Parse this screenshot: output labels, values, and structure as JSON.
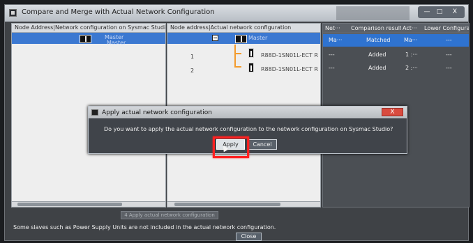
{
  "window": {
    "title": "Compare and Merge with Actual Network Configuration",
    "controls": {
      "minimize": "—",
      "maximize": "□",
      "close": "X"
    }
  },
  "left_pane": {
    "header": "Node Address|Network configuration on Sysmac Studi",
    "master_primary": "Master",
    "master_secondary": "Master"
  },
  "middle_pane": {
    "header": "Node address|Actual network configuration",
    "master": "Master",
    "rows": [
      {
        "node": "1",
        "device": "R88D-1SN01L-ECT R"
      },
      {
        "node": "2",
        "device": "R88D-1SN01L-ECT R"
      }
    ]
  },
  "results": {
    "headers": [
      "Net···",
      "Comparison result",
      "Act···",
      "Lower Configuratio"
    ],
    "rows": [
      {
        "net": "Ma···",
        "comparison": "Matched",
        "act": "Ma···",
        "lower": "---"
      },
      {
        "net": "---",
        "comparison": "Added",
        "act": "1 :···",
        "lower": "---"
      },
      {
        "net": "---",
        "comparison": "Added",
        "act": "2 :···",
        "lower": "---"
      }
    ]
  },
  "dialog": {
    "title": "Apply actual network configuration",
    "close": "X",
    "message": "Do you want to apply the actual network configuration to the network configuration on Sysmac Studio?",
    "apply": "Apply",
    "cancel": "Cancel"
  },
  "footer": {
    "action_button": "4 Apply actual network configuration",
    "note": "Some slaves such as Power Supply Units are not included in the actual network configuration.",
    "close": "Close"
  }
}
